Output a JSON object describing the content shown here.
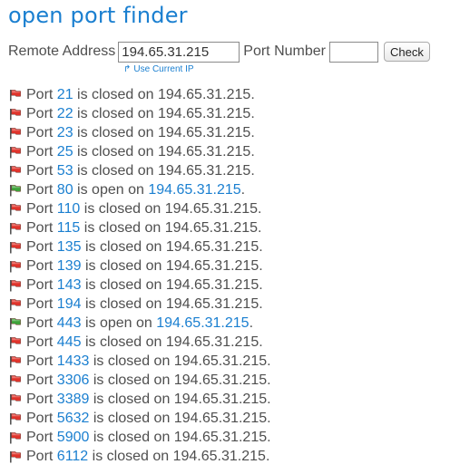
{
  "app": {
    "title": "open port finder"
  },
  "form": {
    "address_label": "Remote Address",
    "address_value": "194.65.31.215",
    "port_label": "Port Number",
    "port_value": "",
    "check_label": "Check",
    "use_current_ip_label": "Use Current IP"
  },
  "colors": {
    "accent": "#1a7fd0",
    "text": "#4f4f4f",
    "closed_flag": "#e0342c",
    "open_flag": "#3ea33a"
  },
  "results": [
    {
      "port": "21",
      "status": "closed",
      "text": "is closed on",
      "ip": "194.65.31.215"
    },
    {
      "port": "22",
      "status": "closed",
      "text": "is closed on",
      "ip": "194.65.31.215"
    },
    {
      "port": "23",
      "status": "closed",
      "text": "is closed on",
      "ip": "194.65.31.215"
    },
    {
      "port": "25",
      "status": "closed",
      "text": "is closed on",
      "ip": "194.65.31.215"
    },
    {
      "port": "53",
      "status": "closed",
      "text": "is closed on",
      "ip": "194.65.31.215"
    },
    {
      "port": "80",
      "status": "open",
      "text": "is open on",
      "ip": "194.65.31.215"
    },
    {
      "port": "110",
      "status": "closed",
      "text": "is closed on",
      "ip": "194.65.31.215"
    },
    {
      "port": "115",
      "status": "closed",
      "text": "is closed on",
      "ip": "194.65.31.215"
    },
    {
      "port": "135",
      "status": "closed",
      "text": "is closed on",
      "ip": "194.65.31.215"
    },
    {
      "port": "139",
      "status": "closed",
      "text": "is closed on",
      "ip": "194.65.31.215"
    },
    {
      "port": "143",
      "status": "closed",
      "text": "is closed on",
      "ip": "194.65.31.215"
    },
    {
      "port": "194",
      "status": "closed",
      "text": "is closed on",
      "ip": "194.65.31.215"
    },
    {
      "port": "443",
      "status": "open",
      "text": "is open on",
      "ip": "194.65.31.215"
    },
    {
      "port": "445",
      "status": "closed",
      "text": "is closed on",
      "ip": "194.65.31.215"
    },
    {
      "port": "1433",
      "status": "closed",
      "text": "is closed on",
      "ip": "194.65.31.215"
    },
    {
      "port": "3306",
      "status": "closed",
      "text": "is closed on",
      "ip": "194.65.31.215"
    },
    {
      "port": "3389",
      "status": "closed",
      "text": "is closed on",
      "ip": "194.65.31.215"
    },
    {
      "port": "5632",
      "status": "closed",
      "text": "is closed on",
      "ip": "194.65.31.215"
    },
    {
      "port": "5900",
      "status": "closed",
      "text": "is closed on",
      "ip": "194.65.31.215"
    },
    {
      "port": "6112",
      "status": "closed",
      "text": "is closed on",
      "ip": "194.65.31.215"
    }
  ],
  "labels": {
    "port_word": "Port"
  }
}
